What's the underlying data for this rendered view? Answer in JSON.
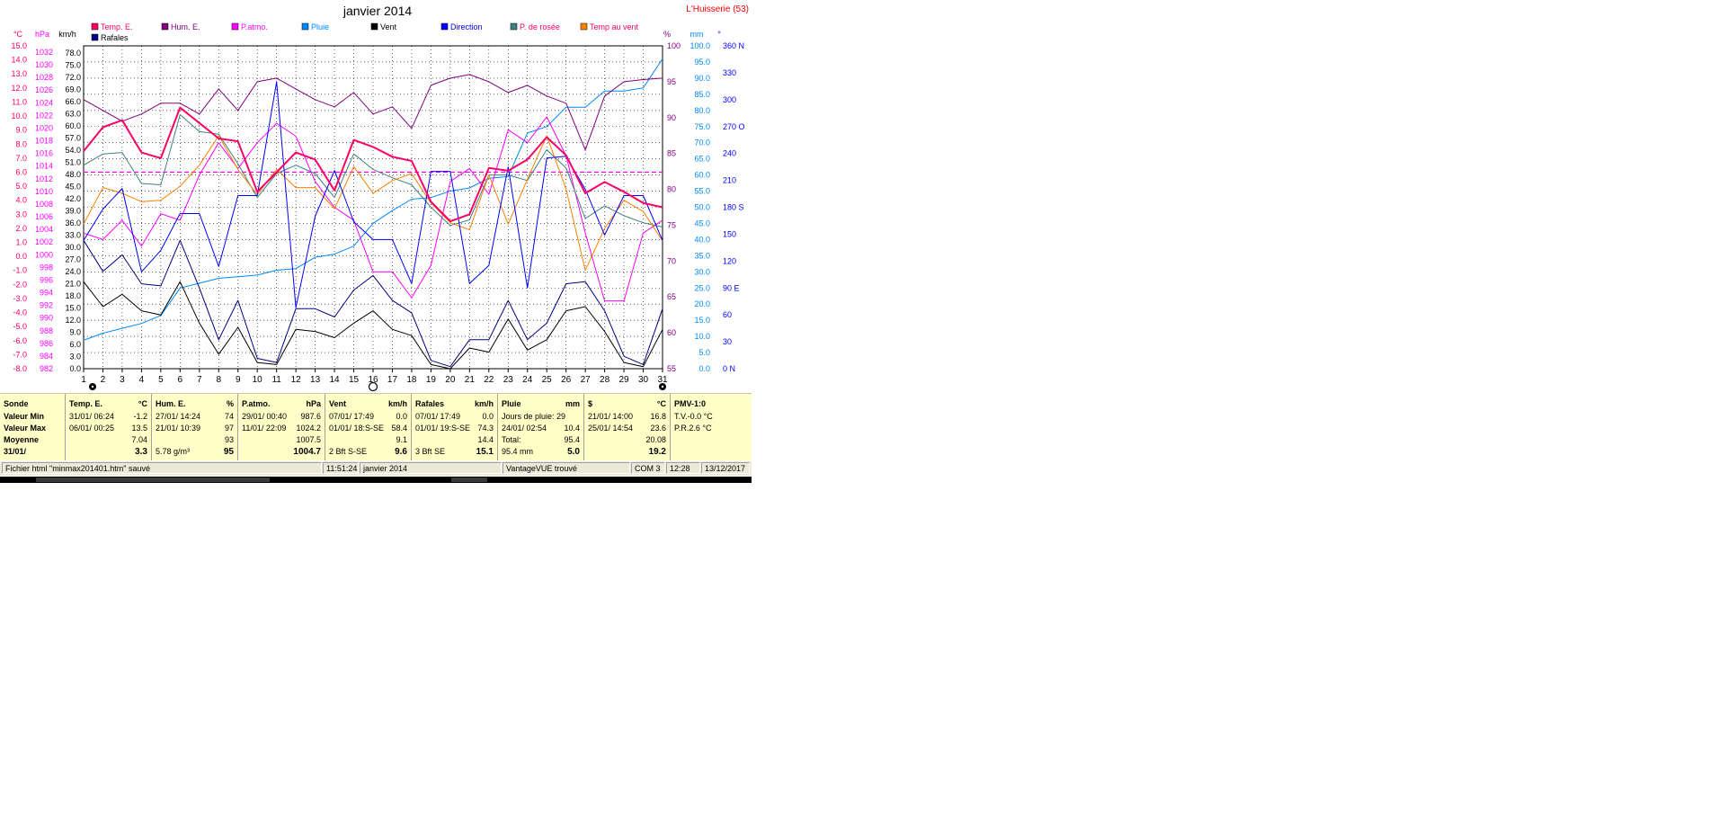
{
  "window": {
    "title": "janvier 2014",
    "station": "L'Huisserie (53)"
  },
  "chart_data": {
    "type": "line",
    "title": "janvier 2014",
    "x": [
      1,
      2,
      3,
      4,
      5,
      6,
      7,
      8,
      9,
      10,
      11,
      12,
      13,
      14,
      15,
      16,
      17,
      18,
      19,
      20,
      21,
      22,
      23,
      24,
      25,
      26,
      27,
      28,
      29,
      30,
      31
    ],
    "axes": {
      "temp": {
        "label": "°C",
        "ylim": [
          -8,
          15
        ],
        "ticks": [
          "15.0",
          "14.0",
          "13.0",
          "12.0",
          "11.0",
          "10.0",
          "9.0",
          "8.0",
          "7.0",
          "6.0",
          "5.0",
          "4.0",
          "3.0",
          "2.0",
          "1.0",
          "0.0",
          "-1.0",
          "-2.0",
          "-3.0",
          "-4.0",
          "-5.0",
          "-6.0",
          "-7.0",
          "-8.0"
        ]
      },
      "pressure": {
        "label": "hPa",
        "ylim": [
          982,
          1032
        ],
        "ticks": [
          "1032",
          "1030",
          "1028",
          "1026",
          "1024",
          "1022",
          "1020",
          "1018",
          "1016",
          "1014",
          "1012",
          "1010",
          "1008",
          "1006",
          "1004",
          "1002",
          "1000",
          "998",
          "996",
          "994",
          "992",
          "990",
          "988",
          "986",
          "984",
          "982"
        ]
      },
      "wind": {
        "label": "km/h",
        "ylim": [
          0,
          78
        ],
        "ticks": [
          "78.0",
          "75.0",
          "72.0",
          "69.0",
          "66.0",
          "63.0",
          "60.0",
          "57.0",
          "54.0",
          "51.0",
          "48.0",
          "45.0",
          "42.0",
          "39.0",
          "36.0",
          "33.0",
          "30.0",
          "27.0",
          "24.0",
          "21.0",
          "18.0",
          "15.0",
          "12.0",
          "9.0",
          "6.0",
          "3.0",
          "0.0"
        ]
      },
      "humidity": {
        "label": "%",
        "ylim": [
          55,
          100
        ],
        "ticks": [
          "100",
          "95",
          "90",
          "85",
          "80",
          "75",
          "70",
          "65",
          "60",
          "55"
        ]
      },
      "rain": {
        "label": "mm",
        "ylim": [
          0,
          100
        ],
        "ticks": [
          "100.0",
          "95.0",
          "90.0",
          "85.0",
          "80.0",
          "75.0",
          "70.0",
          "65.0",
          "60.0",
          "55.0",
          "50.0",
          "45.0",
          "40.0",
          "35.0",
          "30.0",
          "25.0",
          "20.0",
          "15.0",
          "10.0",
          "5.0",
          "0.0"
        ]
      },
      "direction": {
        "label": "°",
        "ylim": [
          0,
          360
        ],
        "ticks": [
          "360 N",
          "330",
          "300",
          "270 O",
          "240",
          "210",
          "180 S",
          "150",
          "120",
          "90  E",
          "60",
          "30",
          "0    N"
        ]
      }
    },
    "series": [
      {
        "name": "Temp. E.",
        "axis": "temp",
        "color": "#ff0066",
        "width": 2,
        "values": [
          7.5,
          9.2,
          9.7,
          7.4,
          7.0,
          10.6,
          9.5,
          8.4,
          8.2,
          4.6,
          6.0,
          7.4,
          6.9,
          4.7,
          8.3,
          7.8,
          7.1,
          6.8,
          3.9,
          2.5,
          3.0,
          6.3,
          6.1,
          6.9,
          8.5,
          7.2,
          4.5,
          5.3,
          4.6,
          3.8,
          3.5
        ]
      },
      {
        "name": "Hum. E.",
        "axis": "humidity",
        "color": "#800080",
        "width": 1,
        "values": [
          92.5,
          91,
          89.5,
          90.5,
          92,
          92,
          90.5,
          94,
          91,
          95,
          95.5,
          94,
          92.5,
          91.5,
          93.5,
          90.5,
          91.5,
          88.5,
          94.5,
          95.5,
          96,
          95,
          93.5,
          94.5,
          93,
          92,
          85.5,
          93,
          95,
          95.3,
          95.5
        ]
      },
      {
        "name": "P.atmo.",
        "axis": "pressure",
        "color": "#ff00ff",
        "width": 1,
        "values": [
          1003,
          1002,
          1005,
          1001,
          1006,
          1005,
          1012,
          1017,
          1013,
          1017,
          1020,
          1018,
          1011,
          1007,
          1005,
          997,
          997,
          993,
          998,
          1011,
          1013,
          1009,
          1019,
          1017,
          1021,
          1015,
          1003,
          992.5,
          992.5,
          1003,
          1005
        ]
      },
      {
        "name": "Pluie",
        "axis": "rain",
        "color": "#0088ff",
        "width": 1,
        "values": [
          8.8,
          11,
          12.5,
          14,
          16.5,
          25,
          26.5,
          28,
          28.5,
          29,
          30.5,
          31,
          34.5,
          35.5,
          38,
          45,
          49,
          52.5,
          53,
          55,
          56,
          59,
          59.5,
          73,
          75,
          81,
          81,
          86,
          86,
          87,
          96
        ]
      },
      {
        "name": "Vent",
        "axis": "wind",
        "color": "#000000",
        "width": 1,
        "values": [
          21,
          15,
          18,
          14,
          13,
          21,
          11,
          3.5,
          10,
          1.5,
          1,
          9.5,
          9,
          7.5,
          11,
          14,
          9.5,
          8,
          1,
          0,
          5,
          4,
          12,
          4.5,
          7,
          14,
          15,
          9,
          1.5,
          0.5,
          9.5
        ]
      },
      {
        "name": "Direction",
        "axis": "direction",
        "color": "#0000ff",
        "width": 1,
        "values": [
          143,
          178,
          201,
          108,
          132,
          173,
          173,
          114,
          193,
          193,
          320,
          68,
          170,
          221,
          164,
          144,
          144,
          95,
          220,
          220,
          95,
          115,
          225,
          90,
          235,
          237,
          200,
          149,
          193,
          193,
          143
        ]
      },
      {
        "name": "P. de rosée",
        "axis": "temp",
        "color": "#408080",
        "width": 1,
        "values": [
          6.5,
          7.3,
          7.4,
          5.2,
          5.1,
          10.1,
          8.9,
          8.7,
          6.6,
          4.2,
          5.9,
          6.5,
          5.9,
          4.2,
          7.3,
          6.2,
          5.6,
          5.1,
          3.5,
          2.2,
          2.6,
          5.8,
          5.8,
          5.4,
          7.6,
          6.3,
          2.7,
          3.6,
          2.9,
          2.4,
          2.1
        ]
      },
      {
        "name": "Temp au vent",
        "axis": "temp",
        "color": "#ff8000",
        "width": 1,
        "values": [
          2.3,
          4.9,
          4.5,
          3.9,
          4.0,
          5.0,
          6.5,
          8.6,
          6.2,
          4.4,
          6.2,
          4.9,
          4.9,
          3.4,
          6.4,
          4.5,
          5.4,
          5.9,
          3.8,
          2.4,
          1.9,
          5.8,
          2.3,
          5.5,
          8.6,
          4.8,
          -1.0,
          2.0,
          4.0,
          3.2,
          1.1
        ]
      },
      {
        "name": "Rafales",
        "axis": "wind",
        "color": "#000080",
        "width": 1,
        "values": [
          31,
          23.5,
          27.5,
          20.5,
          20,
          31,
          19.5,
          7,
          16.5,
          2.5,
          1.5,
          14.5,
          14.5,
          12.5,
          19,
          22.5,
          16.5,
          13.5,
          2,
          0.5,
          7,
          7,
          16.5,
          7,
          11,
          20.5,
          21,
          14,
          3,
          1,
          14.5
        ]
      }
    ],
    "hline": {
      "axis": "temp",
      "value": 6,
      "color": "#ff00ff",
      "style": "dashed"
    },
    "moon_phases": [
      {
        "day": 1,
        "phase": "new"
      },
      {
        "day": 16,
        "phase": "full"
      },
      {
        "day": 31,
        "phase": "new"
      }
    ],
    "legend": [
      {
        "label": "Temp. E.",
        "color": "#ff0066",
        "textcolor": "#ff0066"
      },
      {
        "label": "Hum. E.",
        "color": "#800080",
        "textcolor": "#800080"
      },
      {
        "label": "P.atmo.",
        "color": "#ff00ff",
        "textcolor": "#ff00ff"
      },
      {
        "label": "Pluie",
        "color": "#0088ff",
        "textcolor": "#0088ff"
      },
      {
        "label": "Vent",
        "color": "#000000",
        "textcolor": "#000000"
      },
      {
        "label": "Direction",
        "color": "#0000ff",
        "textcolor": "#0000ff"
      },
      {
        "label": "P. de rosée",
        "color": "#408080",
        "textcolor": "#ff0066"
      },
      {
        "label": "Temp au vent",
        "color": "#ff8000",
        "textcolor": "#ff0066"
      },
      {
        "label": "Rafales",
        "color": "#000080",
        "textcolor": "#000000"
      }
    ],
    "grid": true
  },
  "stats": {
    "labels": {
      "title": "Sonde",
      "min": "Valeur Min",
      "max": "Valeur Max",
      "avg": "Moyenne",
      "last": "31/01/"
    },
    "columns": [
      {
        "title": "Temp. E.",
        "unit": "°C",
        "min_date": "31/01/  06:24",
        "min": "-1.2",
        "max_date": "06/01/  00:25",
        "max": "13.5",
        "avg_note": "",
        "avg": "7.04",
        "last_note": "",
        "last": "3.3"
      },
      {
        "title": "Hum. E.",
        "unit": "%",
        "min_date": "27/01/  14:24",
        "min": "74",
        "max_date": "21/01/  10:39",
        "max": "97",
        "avg_note": "",
        "avg": "93",
        "last_note": "5.78 g/m³",
        "last": "95"
      },
      {
        "title": "P.atmo.",
        "unit": "hPa",
        "min_date": "29/01/  00:40",
        "min": "987.6",
        "max_date": "11/01/  22:09",
        "max": "1024.2",
        "avg_note": "",
        "avg": "1007.5",
        "last_note": "",
        "last": "1004.7"
      },
      {
        "title": "Vent",
        "unit": "km/h",
        "min_date": "07/01/  17:49",
        "min": "0.0",
        "max_date": "01/01/  18:S-SE",
        "max": "58.4",
        "avg_note": "",
        "avg": "9.1",
        "last_note": "2 Bft S-SE",
        "last": "9.6"
      },
      {
        "title": "Rafales",
        "unit": "km/h",
        "min_date": "07/01/  17:49",
        "min": "0.0",
        "max_date": "01/01/  19:S-SE",
        "max": "74.3",
        "avg_note": "",
        "avg": "14.4",
        "last_note": "3 Bft SE",
        "last": "15.1"
      },
      {
        "title": "Pluie",
        "unit": "mm",
        "min_date": "Jours de pluie: 29",
        "min": "",
        "max_date": "24/01/  02:54",
        "max": "10.4",
        "avg_note": "Total:",
        "avg": "95.4",
        "last_note": "95.4 mm",
        "last": "5.0"
      },
      {
        "title": "$",
        "unit": "°C",
        "min_date": "21/01/  14:00",
        "min": "16.8",
        "max_date": "25/01/  14:54",
        "max": "23.6",
        "avg_note": "",
        "avg": "20.08",
        "last_note": "",
        "last": "19.2"
      }
    ],
    "pmv": {
      "title": "PMV-1:0",
      "tv": "T.V.-0.0 °C",
      "pr": "P.R.2.6 °C"
    }
  },
  "statusbar": {
    "message": "Fichier html  \"minmax201401.htm\"  sauvé",
    "time1": "11:51:24",
    "period": "janvier 2014",
    "station": "VantageVUE trouvé",
    "port": "COM 3",
    "time2": "12:28",
    "date": "13/12/2017"
  }
}
